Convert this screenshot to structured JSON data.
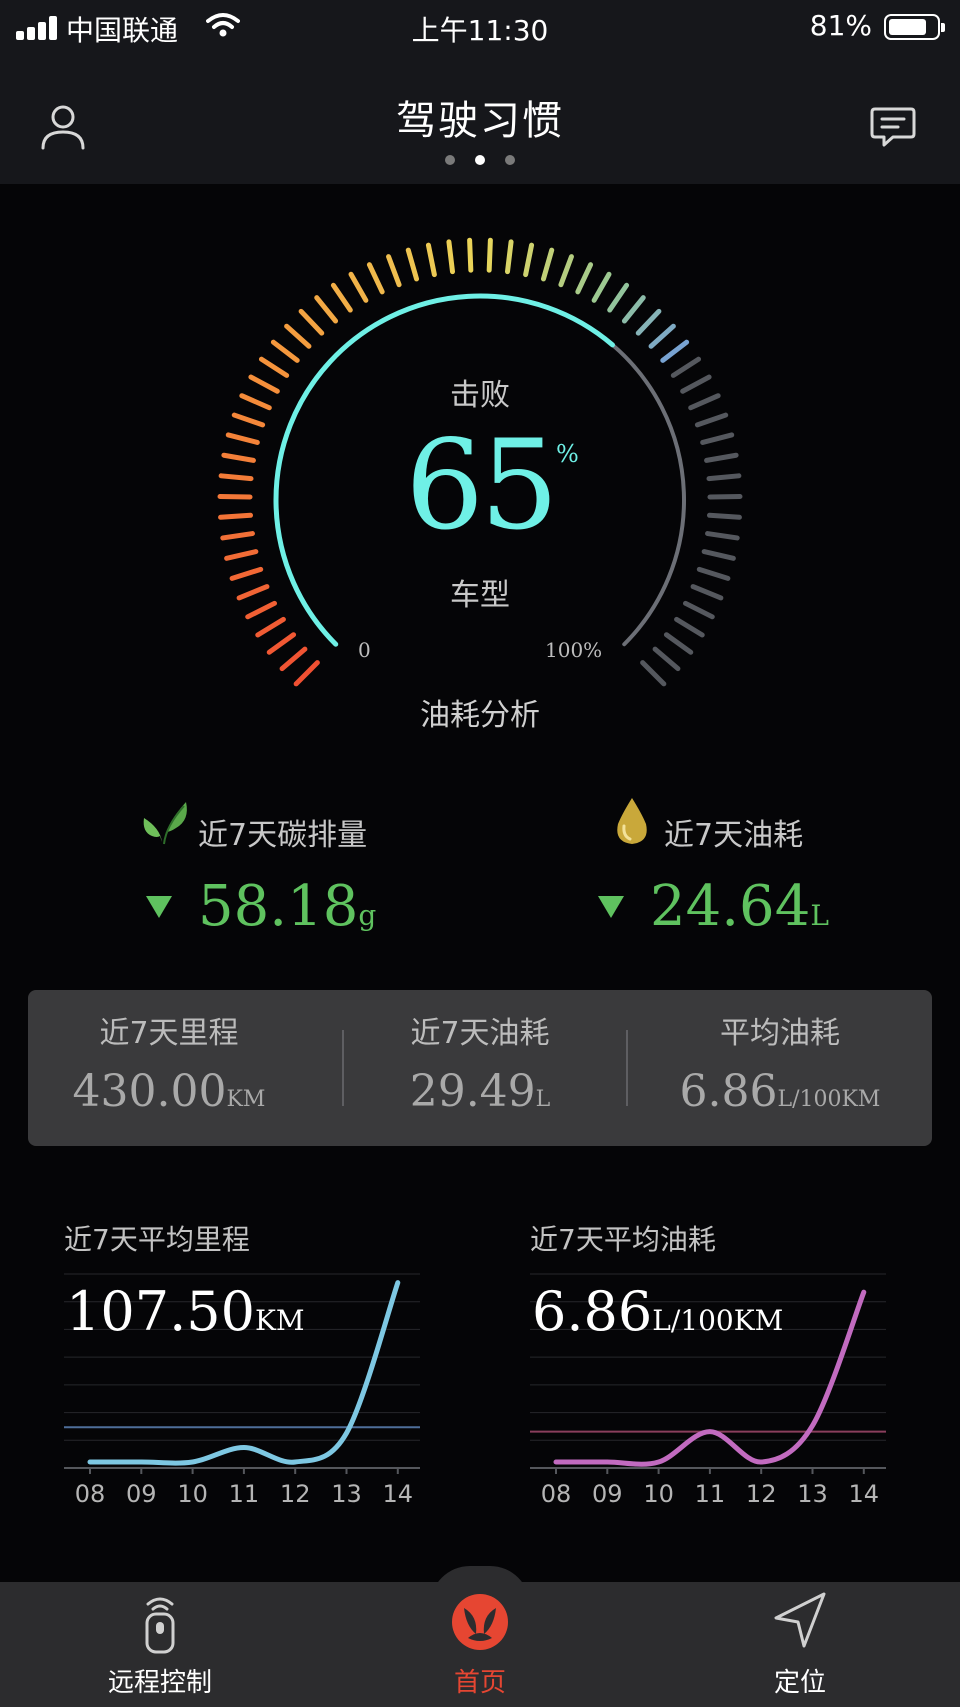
{
  "status_bar": {
    "carrier": "中国联通",
    "time": "上午11:30",
    "battery": "81%",
    "battery_level": 0.81
  },
  "nav": {
    "title": "驾驶习惯",
    "page_count": 3,
    "active_page": 1,
    "profile_icon": "user-icon",
    "message_icon": "message-icon"
  },
  "gauge": {
    "top_label": "击败",
    "value": "65",
    "unit": "%",
    "bottom_label": "车型",
    "min_label": "0",
    "max_label": "100%",
    "caption": "油耗分析",
    "percent": 65,
    "accent_color": "#6ff0e6"
  },
  "stats": {
    "carbon": {
      "icon": "leaf-icon",
      "label": "近7天碳排量",
      "trend": "down",
      "value": "58.18",
      "unit": "g"
    },
    "fuel": {
      "icon": "oil-drop-icon",
      "label": "近7天油耗",
      "trend": "down",
      "value": "24.64",
      "unit": "L"
    },
    "trend_color": "#5fc25f"
  },
  "summary": [
    {
      "label": "近7天里程",
      "value": "430.00",
      "unit": "KM"
    },
    {
      "label": "近7天油耗",
      "value": "29.49",
      "unit": "L"
    },
    {
      "label": "平均油耗",
      "value": "6.86",
      "unit": "L/100KM"
    }
  ],
  "chart_data": [
    {
      "type": "line",
      "title": "近7天平均里程",
      "headline_value": "107.50",
      "headline_unit": "KM",
      "categories": [
        "08",
        "09",
        "10",
        "11",
        "12",
        "13",
        "14"
      ],
      "values": [
        0,
        0,
        0,
        5,
        0,
        10,
        62
      ],
      "average_line": 12,
      "ylim": [
        0,
        65
      ],
      "color": "#7ec8e3",
      "average_color": "#4e6e9a"
    },
    {
      "type": "line",
      "title": "近7天平均油耗",
      "headline_value": "6.86",
      "headline_unit": "L/100KM",
      "categories": [
        "08",
        "09",
        "10",
        "11",
        "12",
        "13",
        "14"
      ],
      "values": [
        0,
        0,
        0,
        1,
        0,
        1.2,
        5.6
      ],
      "average_line": 1,
      "ylim": [
        0,
        6.2
      ],
      "color": "#c26bc0",
      "average_color": "#8a3f5d"
    }
  ],
  "tabs": [
    {
      "label": "远程控制",
      "icon": "remote-key-icon",
      "active": false
    },
    {
      "label": "首页",
      "icon": "brand-logo-icon",
      "active": true
    },
    {
      "label": "定位",
      "icon": "location-arrow-icon",
      "active": false
    }
  ]
}
